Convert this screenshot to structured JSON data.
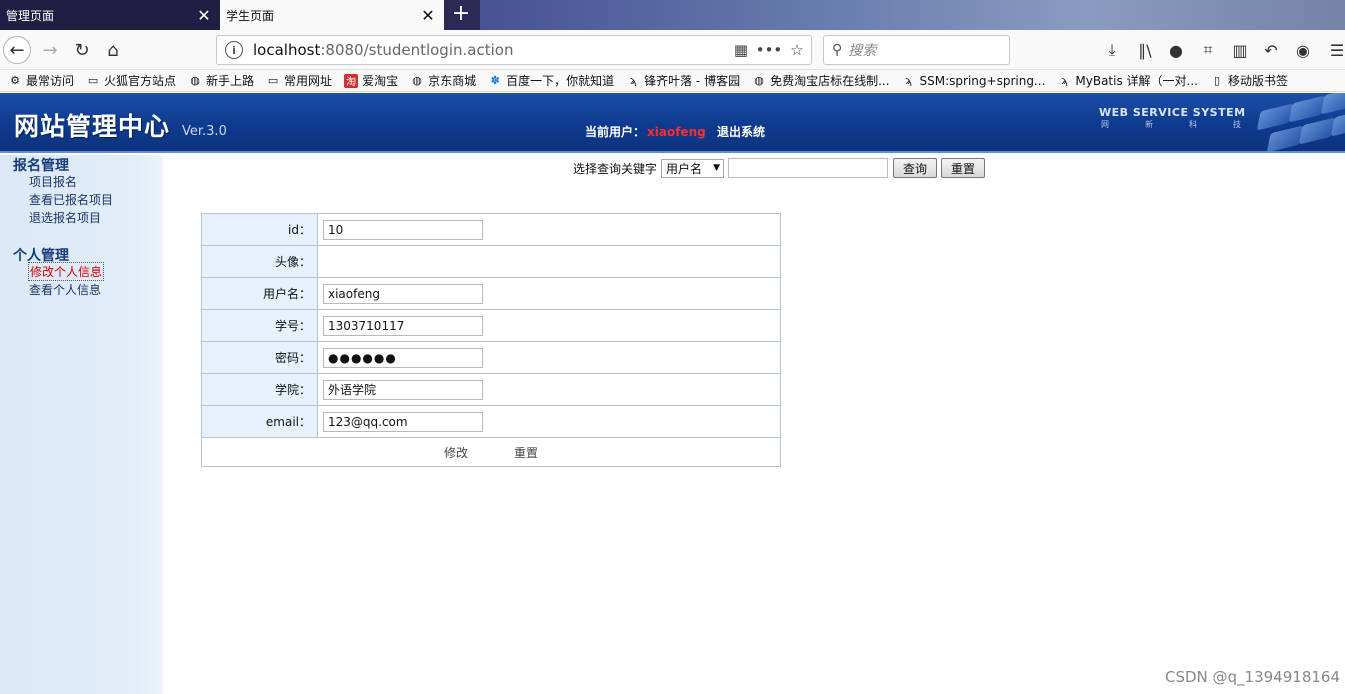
{
  "browser": {
    "tabs": [
      {
        "title": "管理页面",
        "active": false
      },
      {
        "title": "学生页面",
        "active": true
      }
    ],
    "url_host": "localhost",
    "url_rest": ":8080/studentlogin.action",
    "search_placeholder": "搜索",
    "bookmarks": [
      "最常访问",
      "火狐官方站点",
      "新手上路",
      "常用网址",
      "爱淘宝",
      "京东商城",
      "百度一下，你就知道",
      "锋齐叶落 - 博客园",
      "免费淘宝店标在线制...",
      "SSM:spring+spring...",
      "MyBatis 详解（一对...",
      "移动版书签"
    ]
  },
  "header": {
    "logo": "网站管理中心",
    "version": "Ver.3.0",
    "current_user_label": "当前用户：",
    "current_user": "xiaofeng",
    "logout": "退出系统",
    "ws_title": "WEB SERVICE SYSTEM",
    "ws_sub": [
      "网",
      "新",
      "科",
      "技"
    ]
  },
  "sidebar": {
    "groups": [
      {
        "title": "报名管理",
        "items": [
          "项目报名",
          "查看已报名项目",
          "退选报名项目"
        ]
      },
      {
        "title": "个人管理",
        "items": [
          "修改个人信息",
          "查看个人信息"
        ]
      }
    ],
    "active_item": "修改个人信息"
  },
  "search": {
    "label": "选择查询关键字",
    "select_value": "用户名",
    "query_btn": "查询",
    "reset_btn": "重置"
  },
  "form": {
    "rows": [
      {
        "label": "id：",
        "value": "10"
      },
      {
        "label": "头像：",
        "value": ""
      },
      {
        "label": "用户名：",
        "value": "xiaofeng"
      },
      {
        "label": "学号：",
        "value": "1303710117"
      },
      {
        "label": "密码：",
        "value": "●●●●●●"
      },
      {
        "label": "学院：",
        "value": "外语学院"
      },
      {
        "label": "email：",
        "value": "123@qq.com"
      }
    ],
    "submit": "修改",
    "reset": "重置"
  },
  "watermark": "CSDN @q_1394918164"
}
